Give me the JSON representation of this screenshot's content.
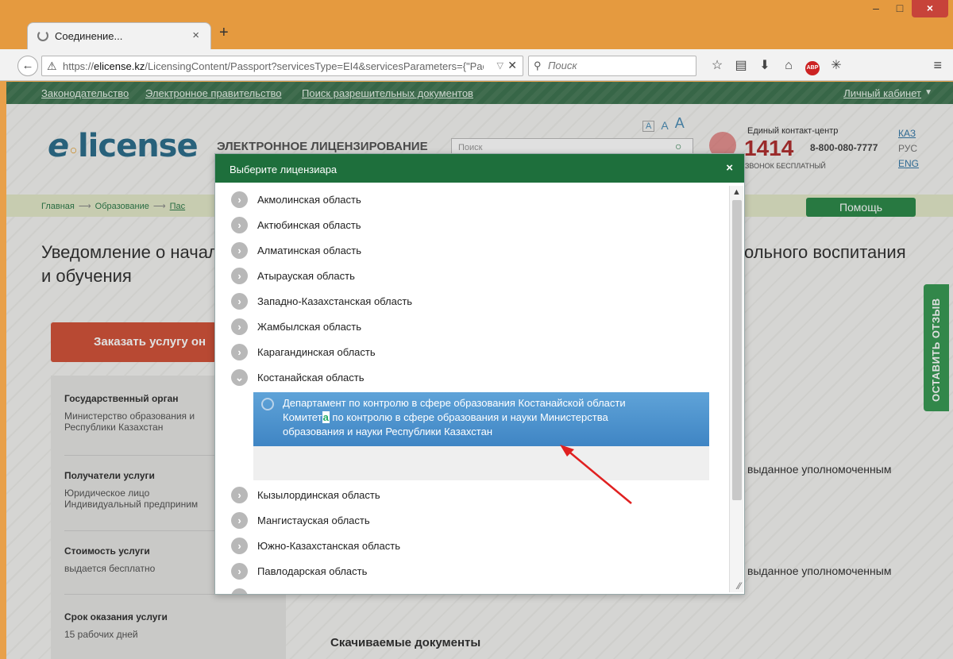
{
  "browser": {
    "tab_title": "Соединение...",
    "tab_close": "×",
    "new_tab": "+",
    "url_host": "elicense.kz",
    "url_prefix": "https://",
    "url_path": "/LicensingContent/Passport?servicesType=EI4&servicesParameters={\"Pac",
    "search_placeholder": "Поиск",
    "window_controls": {
      "minimize": "–",
      "maximize": "□",
      "close": "×"
    }
  },
  "site": {
    "top_nav": [
      "Законодательство",
      "Электронное правительство",
      "Поиск разрешительных документов"
    ],
    "cabinet": "Личный кабинет",
    "logo": "e license",
    "logo_sub": "ЭЛЕКТРОННОЕ ЛИЦЕНЗИРОВАНИЕ",
    "search_placeholder": "Поиск",
    "font_sizes": [
      "A",
      "A",
      "A"
    ],
    "contact": {
      "title": "Единый контакт-центр",
      "number": "1414",
      "free_number": "8-800-080-7777",
      "note": "ЗВОНОК БЕСПЛАТНЫЙ"
    },
    "languages": [
      "КАЗ",
      "РУС",
      "ENG"
    ],
    "breadcrumb": [
      "Главная",
      "Образование",
      "Пас"
    ],
    "help_button": "Помощь",
    "page_title_1": "Уведомление о начал",
    "page_title_2": "и обучения",
    "page_title_right": "ольного воспитания",
    "order_button": "Заказать услугу он",
    "info": [
      {
        "heading": "Государственный орган",
        "text": "Министерство образования и\nРеспублики Казахстан"
      },
      {
        "heading": "Получатели услуги",
        "text": "Юридическое лицо\nИндивидуальный предприним"
      },
      {
        "heading": "Стоимость услуги",
        "text": "выдается бесплатно"
      },
      {
        "heading": "Срок оказания услуги",
        "text": "15 рабочих дней"
      }
    ],
    "right_text_1": "выданное уполномоченным",
    "right_text_2": "выданное уполномоченным",
    "downloads": "Скачиваемые документы",
    "feedback": "ОСТАВИТЬ ОТЗЫВ"
  },
  "modal": {
    "title": "Выберите лицензиара",
    "close": "×",
    "regions": [
      "Акмолинская область",
      "Актюбинская область",
      "Алматинская область",
      "Атырауская область",
      "Западно-Казахстанская область",
      "Жамбылская область",
      "Карагандинская область",
      "Костанайская область",
      "Кызылординская область",
      "Мангистауская область",
      "Южно-Казахстанская область",
      "Павлодарская область"
    ],
    "expanded_region": "Костанайская область",
    "selected_item": {
      "line1": "Департамент по контролю в сфере образования Костанайской области",
      "line2_a": "Комитет",
      "line2_caret": "а",
      "line2_b": " по контролю в сфере образования и науки Министерства",
      "line3": "образования и науки Республики Казахстан"
    }
  },
  "colors": {
    "chrome": "#e59a3f",
    "site_nav": "#3f7551",
    "modal_header": "#1e6f3c",
    "selected": "#4a90cc",
    "order_button": "#d2543b",
    "arrow": "#e02020"
  }
}
